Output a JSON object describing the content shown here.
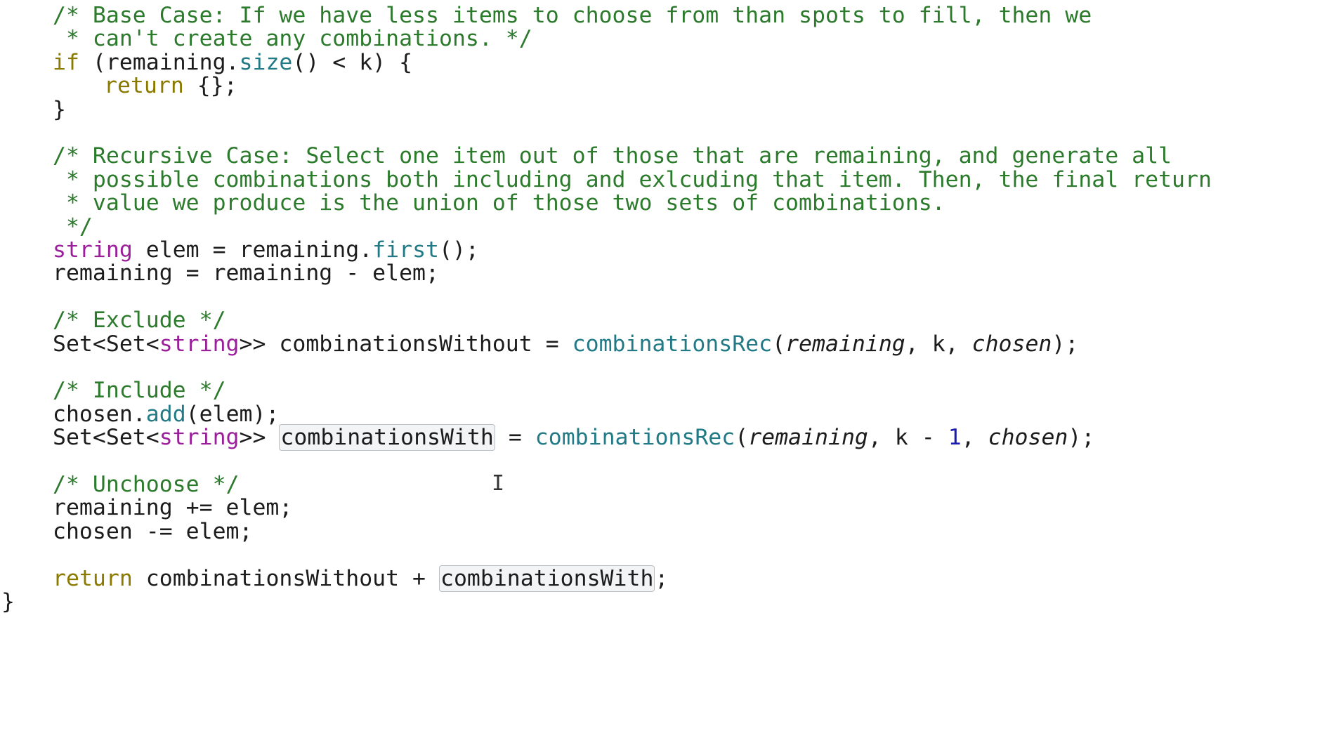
{
  "editor": {
    "lines": [
      {
        "row": 0,
        "indent": 75,
        "tokens": [
          {
            "cls": "comment",
            "text": "/* Base Case: If we have less items to choose from than spots to fill, then we"
          }
        ]
      },
      {
        "row": 1,
        "indent": 75,
        "tokens": [
          {
            "cls": "comment",
            "text": " * can't create any combinations. */"
          }
        ]
      },
      {
        "row": 2,
        "indent": 75,
        "tokens": [
          {
            "cls": "keyword",
            "text": "if"
          },
          {
            "cls": "plain",
            "text": " (remaining."
          },
          {
            "cls": "func",
            "text": "size"
          },
          {
            "cls": "plain",
            "text": "() < k) {"
          }
        ]
      },
      {
        "row": 3,
        "indent": 148,
        "tokens": [
          {
            "cls": "keyword",
            "text": "return"
          },
          {
            "cls": "plain",
            "text": " {};"
          }
        ]
      },
      {
        "row": 4,
        "indent": 75,
        "tokens": [
          {
            "cls": "plain",
            "text": "}"
          }
        ]
      },
      {
        "row": 6,
        "indent": 75,
        "tokens": [
          {
            "cls": "comment",
            "text": "/* Recursive Case: Select one item out of those that are remaining, and generate all"
          }
        ]
      },
      {
        "row": 7,
        "indent": 75,
        "tokens": [
          {
            "cls": "comment",
            "text": " * possible combinations both including and exlcuding that item. Then, the final return"
          }
        ]
      },
      {
        "row": 8,
        "indent": 75,
        "tokens": [
          {
            "cls": "comment",
            "text": " * value we produce is the union of those two sets of combinations."
          }
        ]
      },
      {
        "row": 9,
        "indent": 75,
        "tokens": [
          {
            "cls": "comment",
            "text": " */"
          }
        ]
      },
      {
        "row": 10,
        "indent": 75,
        "tokens": [
          {
            "cls": "type",
            "text": "string"
          },
          {
            "cls": "plain",
            "text": " elem = remaining."
          },
          {
            "cls": "func",
            "text": "first"
          },
          {
            "cls": "plain",
            "text": "();"
          }
        ]
      },
      {
        "row": 11,
        "indent": 75,
        "tokens": [
          {
            "cls": "plain",
            "text": "remaining = remaining - elem;"
          }
        ]
      },
      {
        "row": 13,
        "indent": 75,
        "tokens": [
          {
            "cls": "comment",
            "text": "/* Exclude */"
          }
        ]
      },
      {
        "row": 14,
        "indent": 75,
        "tokens": [
          {
            "cls": "plain",
            "text": "Set<Set<"
          },
          {
            "cls": "type",
            "text": "string"
          },
          {
            "cls": "plain",
            "text": ">> combinationsWithout = "
          },
          {
            "cls": "func",
            "text": "combinationsRec"
          },
          {
            "cls": "plain",
            "text": "("
          },
          {
            "cls": "param",
            "text": "remaining"
          },
          {
            "cls": "plain",
            "text": ", k, "
          },
          {
            "cls": "param",
            "text": "chosen"
          },
          {
            "cls": "plain",
            "text": ");"
          }
        ]
      },
      {
        "row": 16,
        "indent": 75,
        "tokens": [
          {
            "cls": "comment",
            "text": "/* Include */"
          }
        ]
      },
      {
        "row": 17,
        "indent": 75,
        "tokens": [
          {
            "cls": "plain",
            "text": "chosen."
          },
          {
            "cls": "func",
            "text": "add"
          },
          {
            "cls": "plain",
            "text": "(elem);"
          }
        ]
      },
      {
        "row": 18,
        "indent": 75,
        "tokens": [
          {
            "cls": "plain",
            "text": "Set<Set<"
          },
          {
            "cls": "type",
            "text": "string"
          },
          {
            "cls": "plain",
            "text": ">> "
          },
          {
            "cls": "plain",
            "text": "combinationsWith",
            "highlight": true
          },
          {
            "cls": "plain",
            "text": " = "
          },
          {
            "cls": "func",
            "text": "combinationsRec"
          },
          {
            "cls": "plain",
            "text": "("
          },
          {
            "cls": "param",
            "text": "remaining"
          },
          {
            "cls": "plain",
            "text": ", k - "
          },
          {
            "cls": "number",
            "text": "1"
          },
          {
            "cls": "plain",
            "text": ", "
          },
          {
            "cls": "param",
            "text": "chosen"
          },
          {
            "cls": "plain",
            "text": ");"
          }
        ]
      },
      {
        "row": 20,
        "indent": 75,
        "tokens": [
          {
            "cls": "comment",
            "text": "/* Unchoose */"
          }
        ]
      },
      {
        "row": 21,
        "indent": 75,
        "tokens": [
          {
            "cls": "plain",
            "text": "remaining += elem;"
          }
        ]
      },
      {
        "row": 22,
        "indent": 75,
        "tokens": [
          {
            "cls": "plain",
            "text": "chosen -= elem;"
          }
        ]
      },
      {
        "row": 24,
        "indent": 75,
        "tokens": [
          {
            "cls": "keyword",
            "text": "return"
          },
          {
            "cls": "plain",
            "text": " combinationsWithout + "
          },
          {
            "cls": "plain",
            "text": "combinationsWith",
            "highlight": true
          },
          {
            "cls": "plain",
            "text": ";"
          }
        ]
      },
      {
        "row": 25,
        "indent": 2,
        "tokens": [
          {
            "cls": "plain",
            "text": "}"
          }
        ]
      }
    ]
  },
  "colors": {
    "comment": "#2c7a2c",
    "keyword": "#8a7a00",
    "type": "#9b1f9b",
    "function": "#217a86",
    "text": "#1c1c1c",
    "number": "#1c1cb0"
  },
  "cursor": {
    "icon": "text-cursor-icon",
    "glyph": "I"
  }
}
